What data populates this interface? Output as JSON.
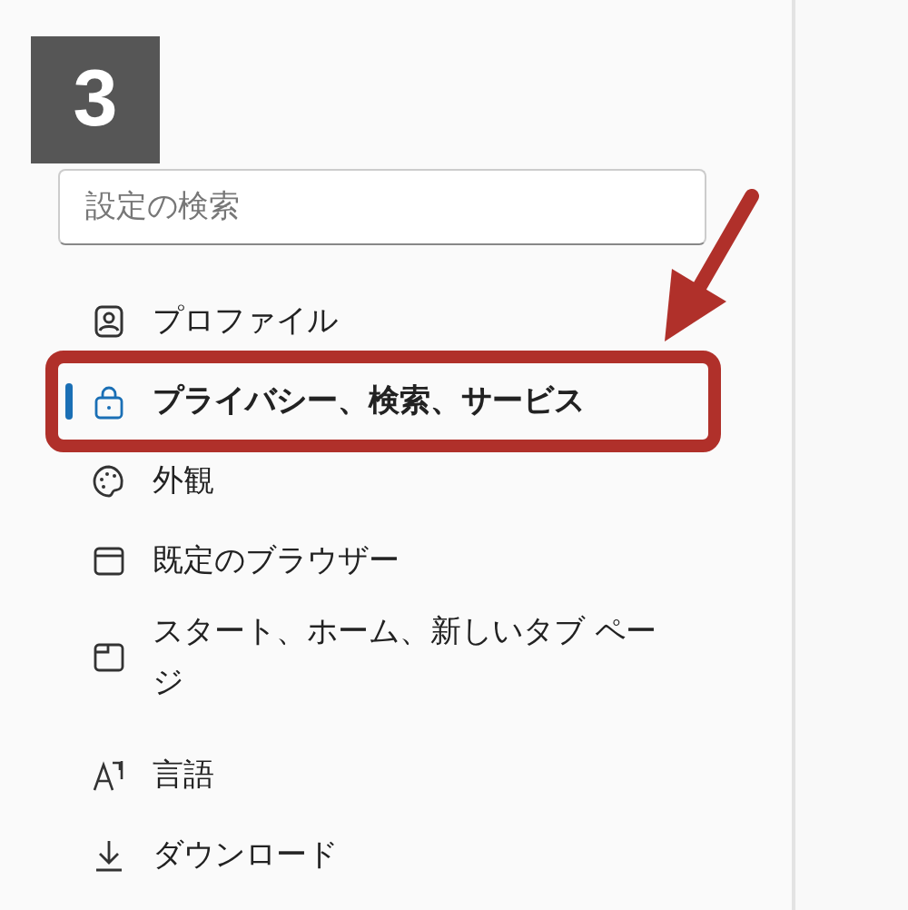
{
  "search": {
    "placeholder": "設定の検索"
  },
  "nav_items": [
    {
      "label": "プロファイル",
      "kind": "profile",
      "selected": false
    },
    {
      "label": "プライバシー、検索、サービス",
      "kind": "privacy",
      "selected": true
    },
    {
      "label": "外観",
      "kind": "appearance",
      "selected": false
    },
    {
      "label": "既定のブラウザー",
      "kind": "browser",
      "selected": false
    },
    {
      "label": "スタート、ホーム、新しいタブ ページ",
      "kind": "start",
      "selected": false
    },
    {
      "label": "言語",
      "kind": "language",
      "selected": false
    },
    {
      "label": "ダウンロード",
      "kind": "download",
      "selected": false
    }
  ],
  "annotation": {
    "step": "3",
    "highlight_selected": true,
    "arrow": true
  }
}
